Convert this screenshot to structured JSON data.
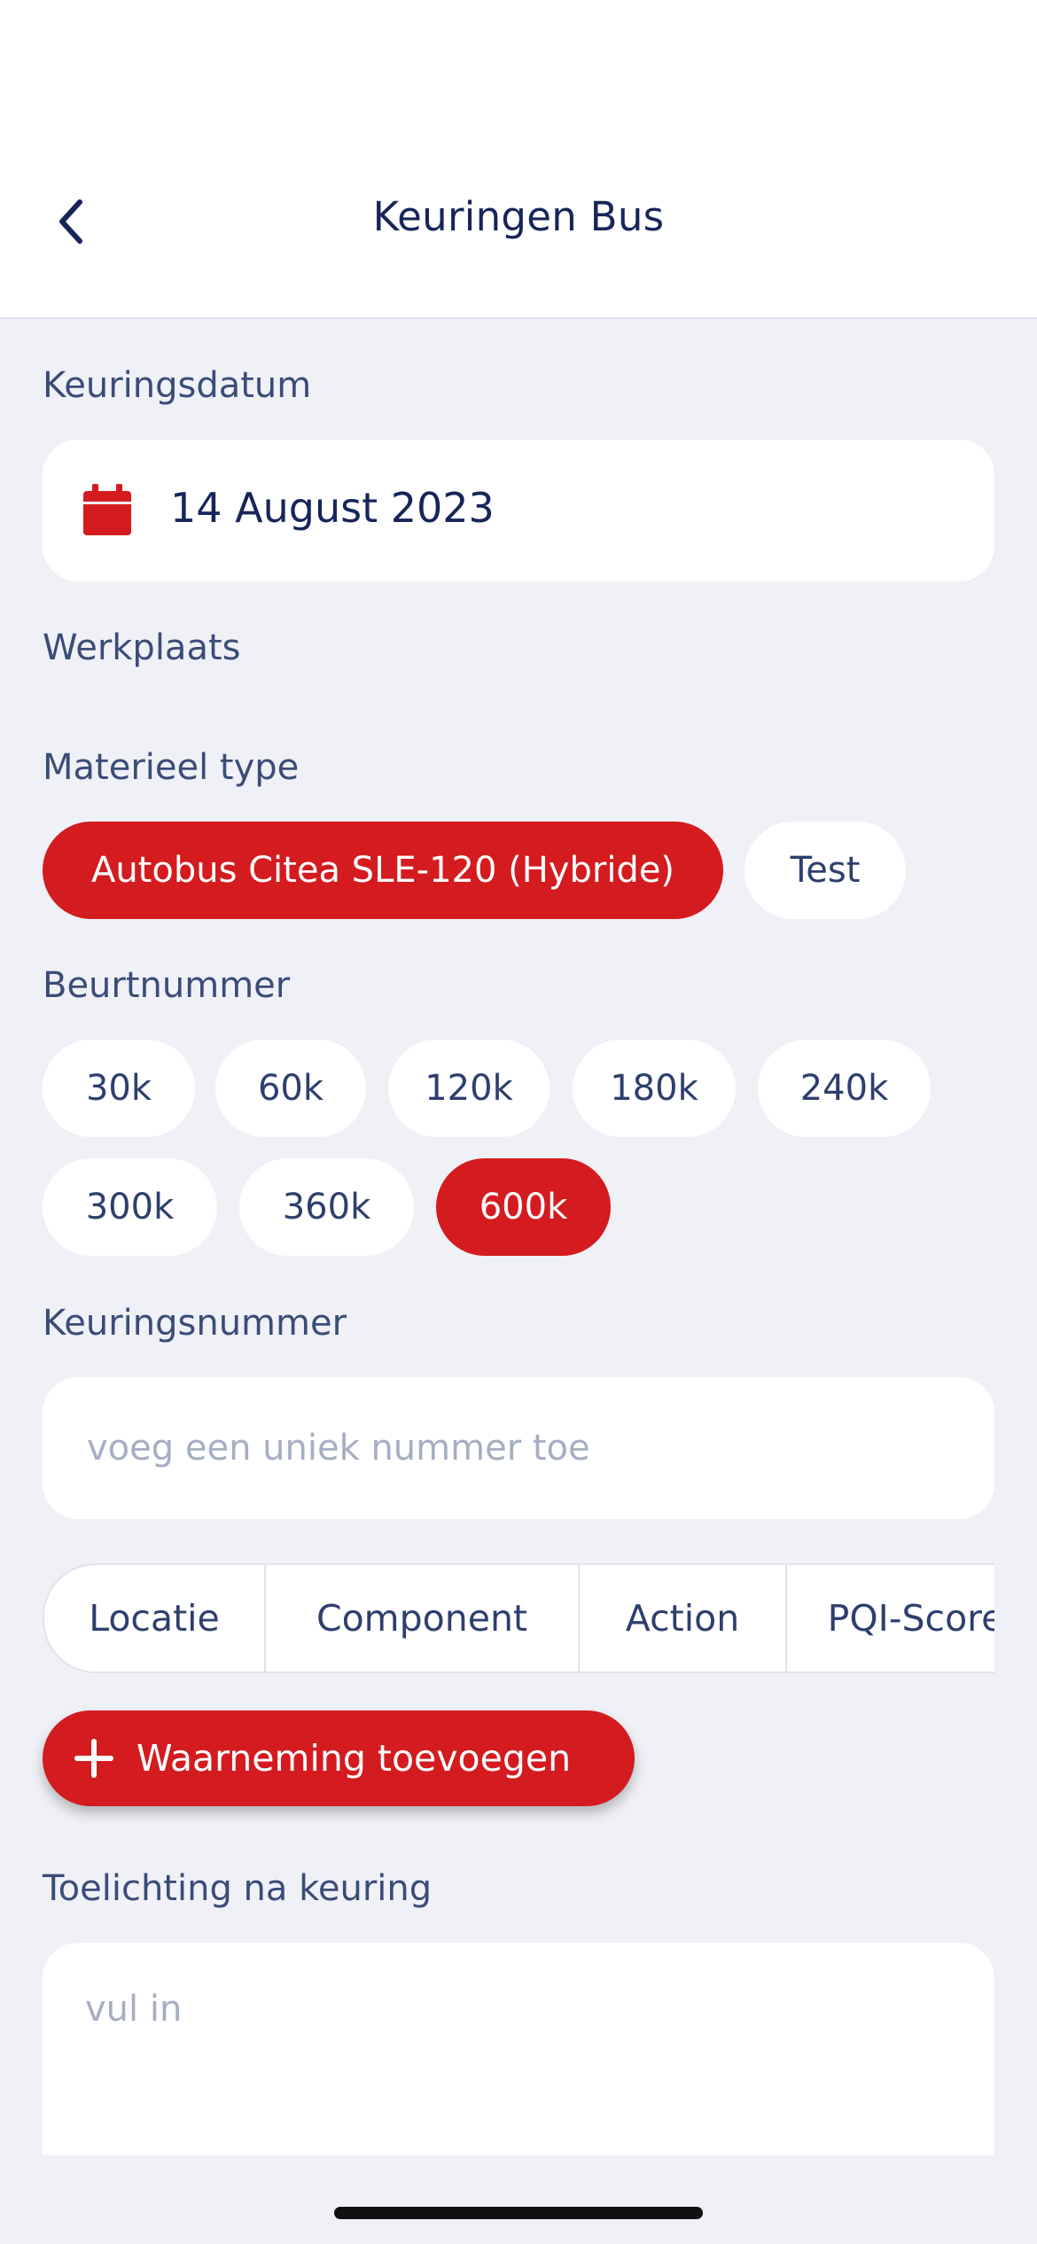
{
  "header": {
    "title": "Keuringen Bus",
    "back_icon": "chevron-left-icon"
  },
  "inspection_date": {
    "label": "Keuringsdatum",
    "value": "14 August 2023",
    "icon": "calendar-icon"
  },
  "workshop": {
    "label": "Werkplaats"
  },
  "material_type": {
    "label": "Materieel type",
    "options": [
      "Autobus Citea SLE-120 (Hybride)",
      "Test"
    ],
    "selected": "Autobus Citea SLE-120 (Hybride)"
  },
  "turn_number": {
    "label": "Beurtnummer",
    "options": [
      "30k",
      "60k",
      "120k",
      "180k",
      "240k",
      "300k",
      "360k",
      "600k"
    ],
    "selected": "600k"
  },
  "inspection_number": {
    "label": "Keuringsnummer",
    "value": "",
    "placeholder": "voeg een uniek nummer toe"
  },
  "observations_table": {
    "columns": [
      "Locatie",
      "Component",
      "Action",
      "PQI-Score"
    ]
  },
  "add_observation": {
    "label": "Waarneming toevoegen",
    "icon": "plus-icon"
  },
  "notes": {
    "label": "Toelichting na keuring",
    "value": "",
    "placeholder": "vul in"
  },
  "colors": {
    "accent": "#D41B1F",
    "background": "#EFF1F6",
    "card": "#FFFFFF",
    "text": "#17255A"
  }
}
